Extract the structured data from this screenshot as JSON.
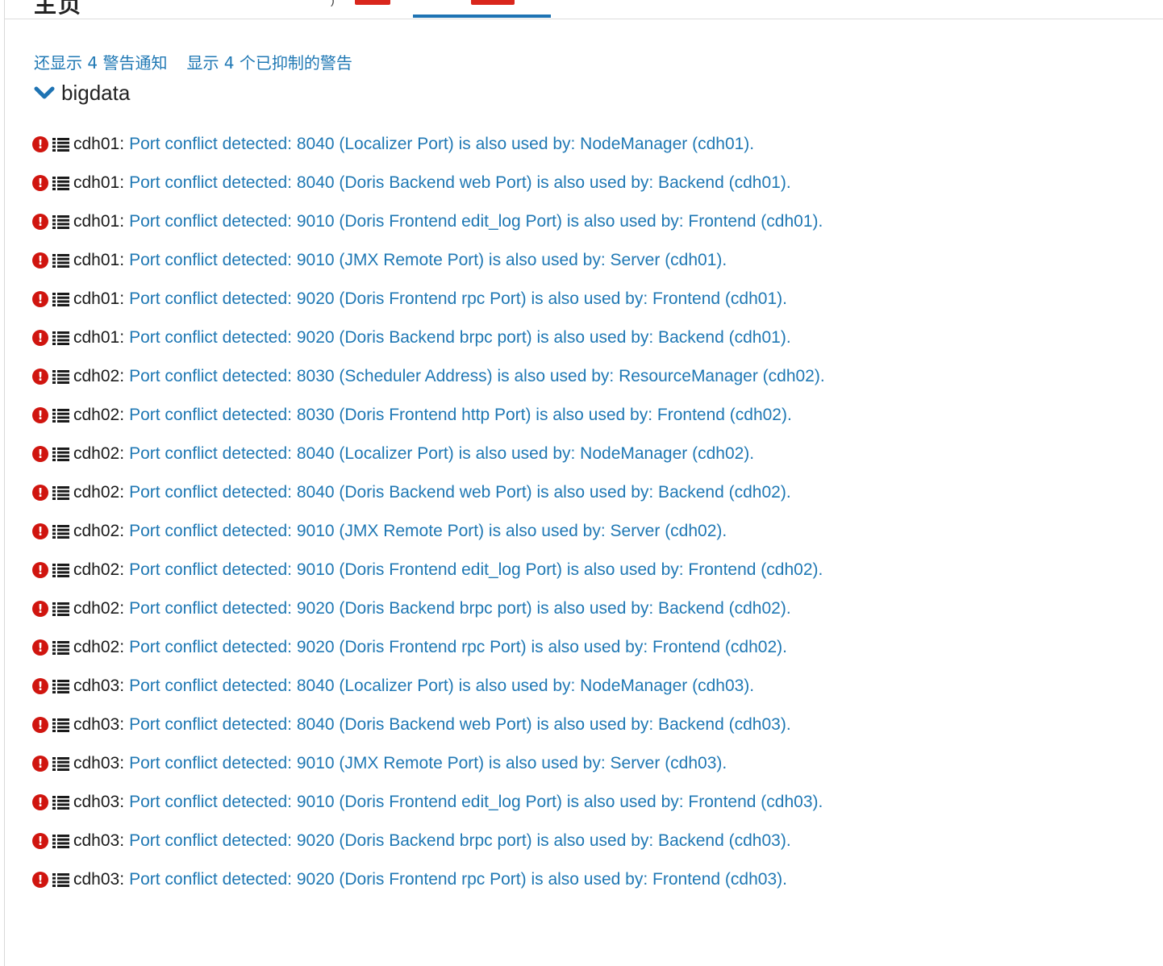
{
  "top_tabs": {
    "heading": "主页",
    "mark": ")"
  },
  "links": {
    "show_alert_notifications": "还显示 4 警告通知",
    "show_suppressed_alerts": "显示 4 个已抑制的警告"
  },
  "group": {
    "title": "bigdata",
    "expanded": true
  },
  "colors": {
    "link": "#1f78b4",
    "error": "#d0150f",
    "tab_active": "#1e73b3",
    "badge": "#d9261c"
  },
  "alerts": [
    {
      "icon": "exclamation-circle-icon",
      "host": "cdh01",
      "sep": ":",
      "message": "Port conflict detected: 8040 (Localizer Port) is also used by: NodeManager (cdh01)."
    },
    {
      "icon": "exclamation-circle-icon",
      "host": "cdh01",
      "sep": ":",
      "message": "Port conflict detected: 8040 (Doris Backend web Port) is also used by: Backend (cdh01)."
    },
    {
      "icon": "exclamation-circle-icon",
      "host": "cdh01",
      "sep": ":",
      "message": "Port conflict detected: 9010 (Doris Frontend edit_log Port) is also used by: Frontend (cdh01)."
    },
    {
      "icon": "exclamation-circle-icon",
      "host": "cdh01",
      "sep": ":",
      "message": "Port conflict detected: 9010 (JMX Remote Port) is also used by: Server (cdh01)."
    },
    {
      "icon": "exclamation-circle-icon",
      "host": "cdh01",
      "sep": ":",
      "message": "Port conflict detected: 9020 (Doris Frontend rpc Port) is also used by: Frontend (cdh01)."
    },
    {
      "icon": "exclamation-circle-icon",
      "host": "cdh01",
      "sep": ":",
      "message": "Port conflict detected: 9020 (Doris Backend brpc port) is also used by: Backend (cdh01)."
    },
    {
      "icon": "exclamation-circle-icon",
      "host": "cdh02",
      "sep": ":",
      "message": "Port conflict detected: 8030 (Scheduler Address) is also used by: ResourceManager (cdh02)."
    },
    {
      "icon": "exclamation-circle-icon",
      "host": "cdh02",
      "sep": ":",
      "message": "Port conflict detected: 8030 (Doris Frontend http Port) is also used by: Frontend (cdh02)."
    },
    {
      "icon": "exclamation-circle-icon",
      "host": "cdh02",
      "sep": ":",
      "message": "Port conflict detected: 8040 (Localizer Port) is also used by: NodeManager (cdh02)."
    },
    {
      "icon": "exclamation-circle-icon",
      "host": "cdh02",
      "sep": ":",
      "message": "Port conflict detected: 8040 (Doris Backend web Port) is also used by: Backend (cdh02)."
    },
    {
      "icon": "exclamation-circle-icon",
      "host": "cdh02",
      "sep": ":",
      "message": "Port conflict detected: 9010 (JMX Remote Port) is also used by: Server (cdh02)."
    },
    {
      "icon": "exclamation-circle-icon",
      "host": "cdh02",
      "sep": ":",
      "message": "Port conflict detected: 9010 (Doris Frontend edit_log Port) is also used by: Frontend (cdh02)."
    },
    {
      "icon": "exclamation-circle-icon",
      "host": "cdh02",
      "sep": ":",
      "message": "Port conflict detected: 9020 (Doris Backend brpc port) is also used by: Backend (cdh02)."
    },
    {
      "icon": "exclamation-circle-icon",
      "host": "cdh02",
      "sep": ":",
      "message": "Port conflict detected: 9020 (Doris Frontend rpc Port) is also used by: Frontend (cdh02)."
    },
    {
      "icon": "exclamation-circle-icon",
      "host": "cdh03",
      "sep": ":",
      "message": "Port conflict detected: 8040 (Localizer Port) is also used by: NodeManager (cdh03)."
    },
    {
      "icon": "exclamation-circle-icon",
      "host": "cdh03",
      "sep": ":",
      "message": "Port conflict detected: 8040 (Doris Backend web Port) is also used by: Backend (cdh03)."
    },
    {
      "icon": "exclamation-circle-icon",
      "host": "cdh03",
      "sep": ":",
      "message": "Port conflict detected: 9010 (JMX Remote Port) is also used by: Server (cdh03)."
    },
    {
      "icon": "exclamation-circle-icon",
      "host": "cdh03",
      "sep": ":",
      "message": "Port conflict detected: 9010 (Doris Frontend edit_log Port) is also used by: Frontend (cdh03)."
    },
    {
      "icon": "exclamation-circle-icon",
      "host": "cdh03",
      "sep": ":",
      "message": "Port conflict detected: 9020 (Doris Backend brpc port) is also used by: Backend (cdh03)."
    },
    {
      "icon": "exclamation-circle-icon",
      "host": "cdh03",
      "sep": ":",
      "message": "Port conflict detected: 9020 (Doris Frontend rpc Port) is also used by: Frontend (cdh03)."
    }
  ]
}
